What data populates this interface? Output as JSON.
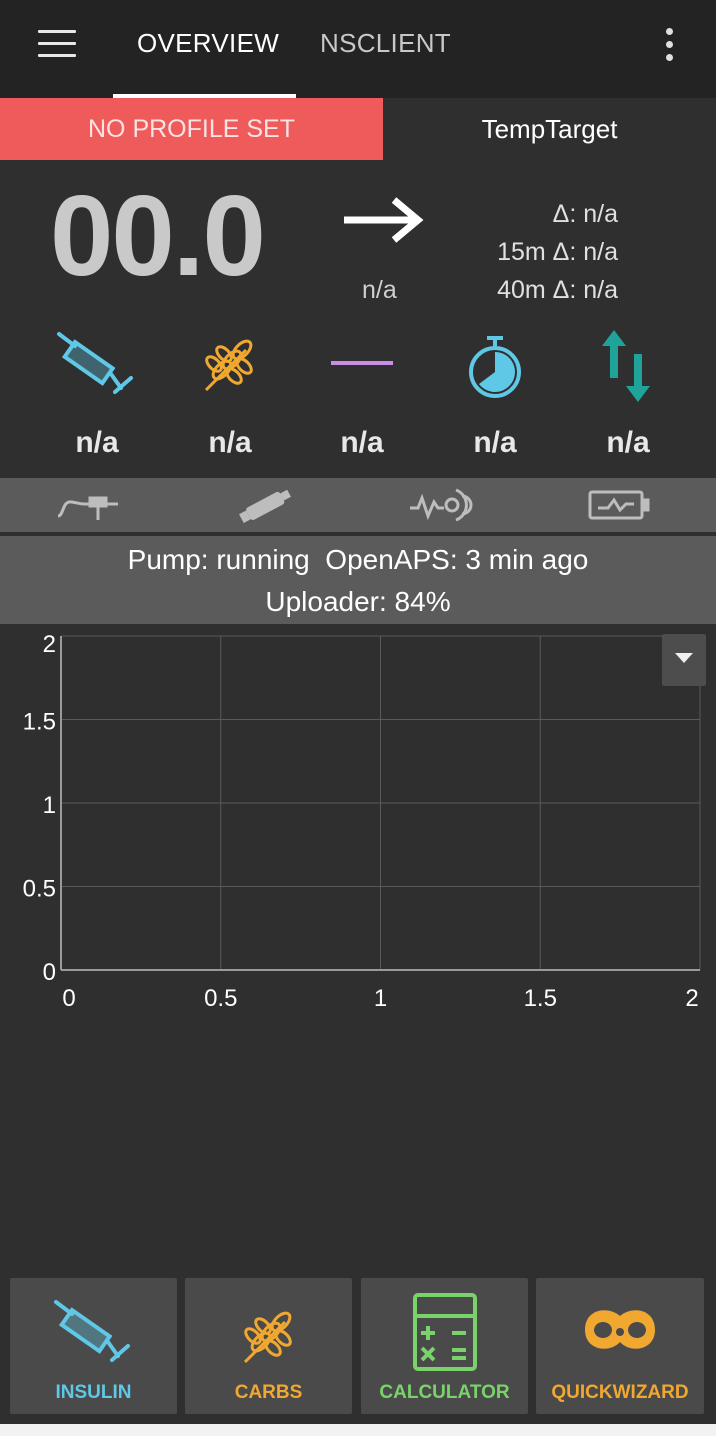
{
  "app_bar": {
    "tabs": [
      {
        "label": "OVERVIEW",
        "active": true
      },
      {
        "label": "NSCLIENT",
        "active": false
      }
    ],
    "menu_icon": "hamburger-menu-icon",
    "overflow_icon": "more-vert-icon"
  },
  "profile": {
    "label": "NO PROFILE SET",
    "color": "#ef5b5b"
  },
  "temp_target": {
    "label": "TempTarget"
  },
  "bg": {
    "value": "00.0",
    "arrow_label": "n/a",
    "delta": "Δ: n/a",
    "delta_15m": "15m Δ: n/a",
    "delta_40m": "40m Δ: n/a"
  },
  "info_icons": [
    {
      "icon": "syringe-icon",
      "value": "n/a",
      "color": "#5fc8e6"
    },
    {
      "icon": "wheat-icon",
      "value": "n/a",
      "color": "#f0a830"
    },
    {
      "icon": "basal-line-icon",
      "value": "n/a",
      "color": "#c88ee6"
    },
    {
      "icon": "timer-icon",
      "value": "n/a",
      "color": "#5fc8e6"
    },
    {
      "icon": "sync-arrows-icon",
      "value": "n/a",
      "color": "#1fa49a"
    }
  ],
  "action_strip": [
    {
      "icon": "cannula-icon"
    },
    {
      "icon": "insulin-reservoir-icon"
    },
    {
      "icon": "sensor-icon"
    },
    {
      "icon": "battery-icon"
    }
  ],
  "status": {
    "line1": "Pump: running  OpenAPS: 3 min ago",
    "line2": "Uploader: 84%"
  },
  "chart_data": {
    "type": "line",
    "series": [],
    "xlim": [
      0,
      2
    ],
    "ylim": [
      0,
      2
    ],
    "x_ticks": [
      "0",
      "0.5",
      "1",
      "1.5",
      "2"
    ],
    "y_ticks": [
      "0",
      "0.5",
      "1",
      "1.5",
      "2"
    ],
    "grid": true
  },
  "chart_menu_icon": "chevron-down-icon",
  "bottom_buttons": [
    {
      "label": "INSULIN",
      "icon": "syringe-icon",
      "color": "#5fc8e6"
    },
    {
      "label": "CARBS",
      "icon": "wheat-icon",
      "color": "#f0a830"
    },
    {
      "label": "CALCULATOR",
      "icon": "calculator-icon",
      "color": "#7ad36a"
    },
    {
      "label": "QUICKWIZARD",
      "icon": "pretzel-icon",
      "color": "#f0a830"
    }
  ]
}
